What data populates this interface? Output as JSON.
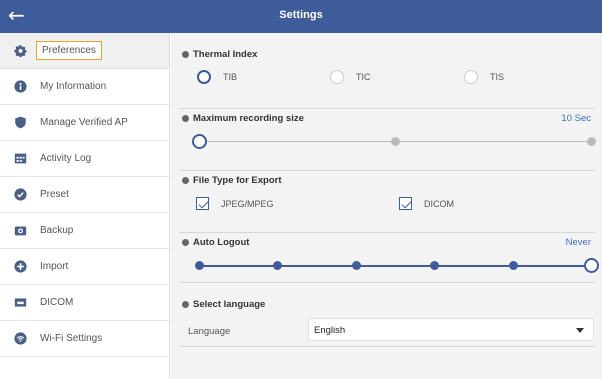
{
  "header": {
    "title": "Settings",
    "back_icon": "arrow-left-icon"
  },
  "sidebar": {
    "items": [
      {
        "label": "Preferences",
        "icon": "gear-icon",
        "active": true
      },
      {
        "label": "My Information",
        "icon": "user-info-icon"
      },
      {
        "label": "Manage Verified AP",
        "icon": "shield-icon"
      },
      {
        "label": "Activity Log",
        "icon": "calendar-icon"
      },
      {
        "label": "Preset",
        "icon": "check-circle-icon"
      },
      {
        "label": "Backup",
        "icon": "backup-icon"
      },
      {
        "label": "Import",
        "icon": "plus-circle-icon"
      },
      {
        "label": "DICOM",
        "icon": "dicom-icon"
      },
      {
        "label": "Wi-Fi Settings",
        "icon": "wifi-icon"
      }
    ]
  },
  "thermal_index": {
    "title": "Thermal Index",
    "options": [
      "TIB",
      "TIC",
      "TIS"
    ],
    "selected": "TIB"
  },
  "max_recording": {
    "title": "Maximum recording size",
    "value": "10 Sec",
    "steps": 3,
    "selected_step": 0
  },
  "export_type": {
    "title": "File Type for Export",
    "options": [
      {
        "label": "JPEG/MPEG",
        "checked": true
      },
      {
        "label": "DICOM",
        "checked": true
      }
    ]
  },
  "auto_logout": {
    "title": "Auto Logout",
    "value": "Never",
    "steps": 6,
    "selected_step": 5
  },
  "language": {
    "title": "Select language",
    "label": "Language",
    "value": "English"
  },
  "colors": {
    "header_bg": "#3e5c9a",
    "accent": "#3e5c9a",
    "value_text": "#3b6fc0",
    "active_outline": "#f0a030"
  }
}
